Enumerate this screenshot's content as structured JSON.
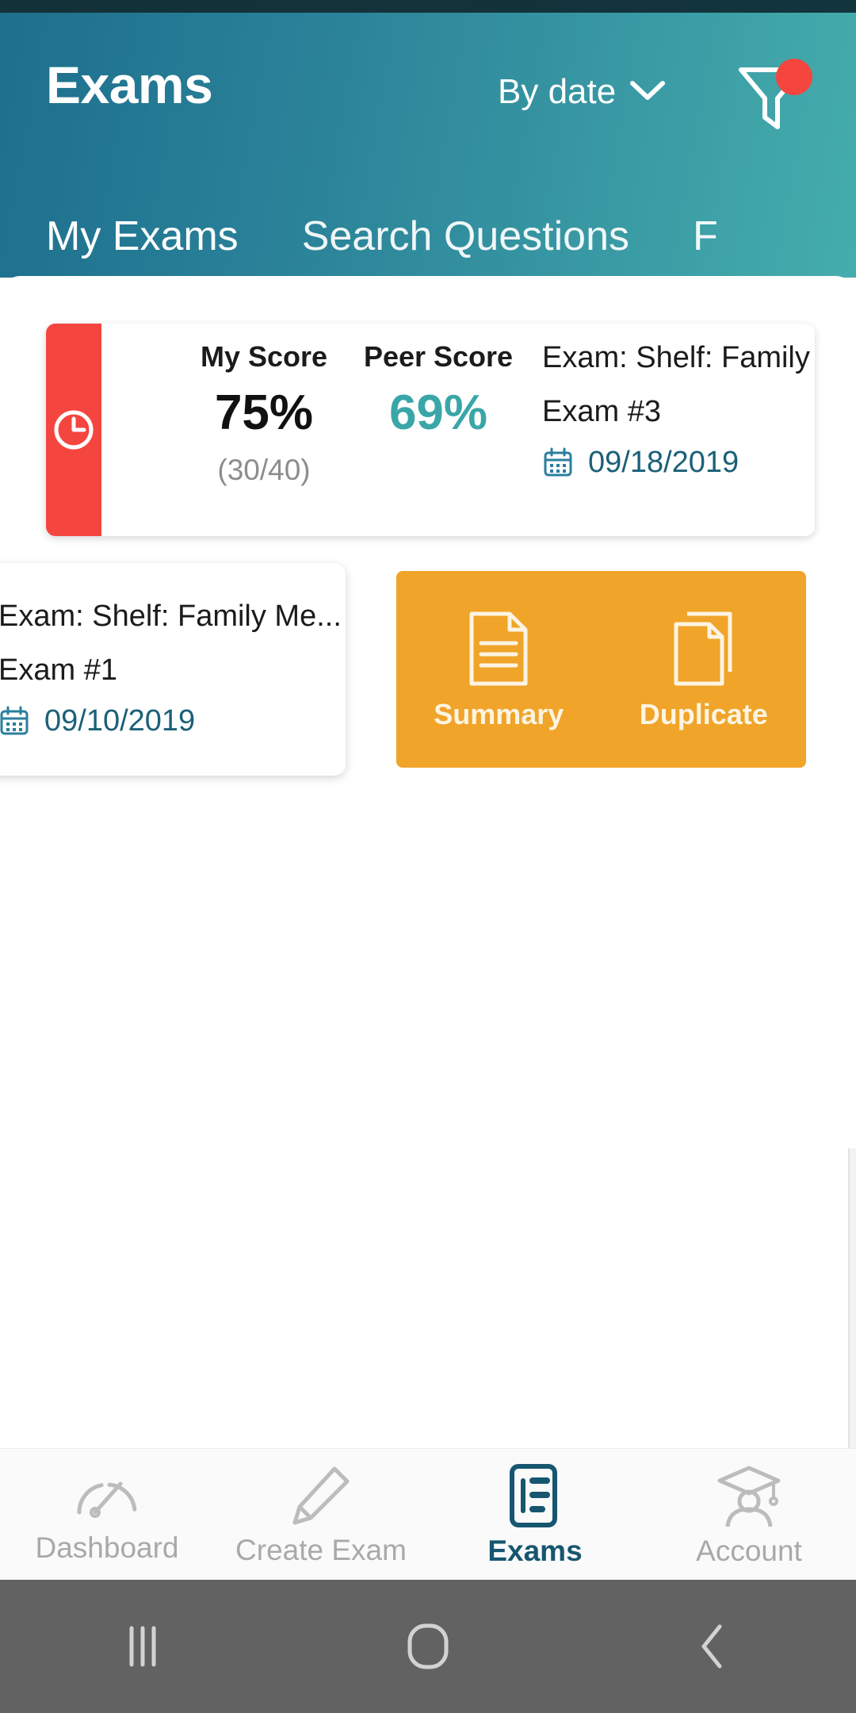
{
  "header": {
    "title": "Exams",
    "sort": {
      "label": "By date",
      "icon": "chevron-down-icon"
    },
    "filter": {
      "icon": "filter-icon",
      "has_badge": true,
      "badge_color": "#f4463f"
    },
    "gradient_from": "#1d6f8e",
    "gradient_to": "#45adad"
  },
  "tabs": [
    {
      "label": "My Exams",
      "active": true
    },
    {
      "label": "Search Questions",
      "active": false
    },
    {
      "label": "F",
      "active": false
    }
  ],
  "score_card": {
    "status_color": "#f4463f",
    "status_icon": "clock-icon",
    "my_score_label": "My Score",
    "peer_score_label": "Peer Score",
    "my_score_value": "75%",
    "my_score_fraction": "(30/40)",
    "peer_score_value": "69%",
    "peer_score_color": "#3aa6a8",
    "exam_title": "Exam: Shelf: Family Me...",
    "exam_number": "Exam #3",
    "date": "09/18/2019",
    "date_icon": "calendar-icon",
    "date_color": "#1b6078"
  },
  "exam_card": {
    "exam_title": "Exam: Shelf: Family Me...",
    "exam_number": "Exam #1",
    "date": "09/10/2019",
    "date_icon": "calendar-icon"
  },
  "action_panel": {
    "background": "#f0a429",
    "actions": [
      {
        "label": "Summary",
        "icon": "document-lines-icon"
      },
      {
        "label": "Duplicate",
        "icon": "copy-documents-icon"
      }
    ]
  },
  "bottom_nav": {
    "active_color": "#17566f",
    "inactive_color": "#a9a9a9",
    "items": [
      {
        "label": "Dashboard",
        "icon": "gauge-icon",
        "active": false
      },
      {
        "label": "Create Exam",
        "icon": "pencil-icon",
        "active": false
      },
      {
        "label": "Exams",
        "icon": "exam-papers-icon",
        "active": true
      },
      {
        "label": "Account",
        "icon": "graduate-icon",
        "active": false
      }
    ]
  },
  "system_bar": {
    "background": "#626262",
    "buttons": [
      {
        "name": "recents-button",
        "icon": "vertical-bars-icon"
      },
      {
        "name": "home-button",
        "icon": "rounded-square-icon"
      },
      {
        "name": "back-button",
        "icon": "chevron-left-icon"
      }
    ]
  }
}
